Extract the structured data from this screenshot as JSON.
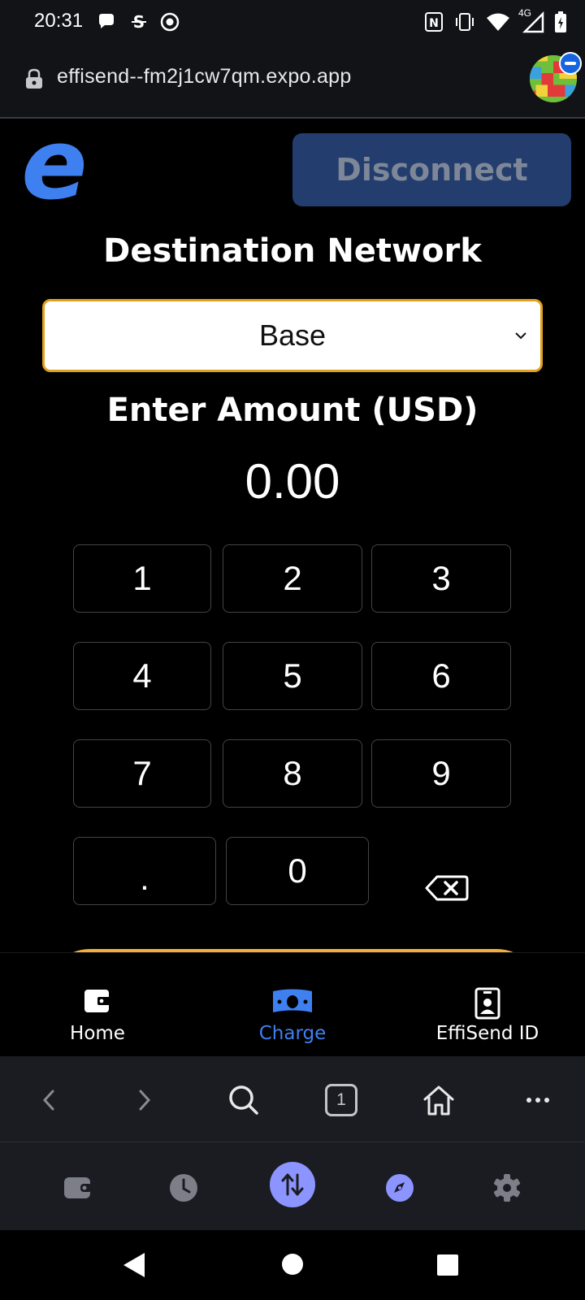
{
  "status_bar": {
    "time": "20:31",
    "network_type": "4G",
    "icons": [
      "chat-bubble-icon",
      "s-icon",
      "record-icon",
      "nfc-icon",
      "vibrate-icon",
      "wifi-icon",
      "signal-icon",
      "battery-icon"
    ]
  },
  "browser": {
    "url": "effisend--fm2j1cw7qm.expo.app",
    "open_tabs": "1"
  },
  "header": {
    "logo_letter": "e",
    "disconnect_label": "Disconnect"
  },
  "network": {
    "title": "Destination Network",
    "selected": "Base"
  },
  "amount": {
    "title": "Enter Amount (USD)",
    "value": "0.00"
  },
  "keypad": {
    "keys": [
      "1",
      "2",
      "3",
      "4",
      "5",
      "6",
      "7",
      "8",
      "9",
      ".",
      "0"
    ]
  },
  "tabs": [
    {
      "label": "Home",
      "icon": "wallet-icon"
    },
    {
      "label": "Charge",
      "icon": "money-icon",
      "active": true
    },
    {
      "label": "EffiSend ID",
      "icon": "id-badge-icon"
    }
  ],
  "colors": {
    "brand_blue": "#3f80f0",
    "accent_orange": "#f2ae40",
    "select_border": "#e0a21c",
    "dock_active": "#8b94ff"
  }
}
